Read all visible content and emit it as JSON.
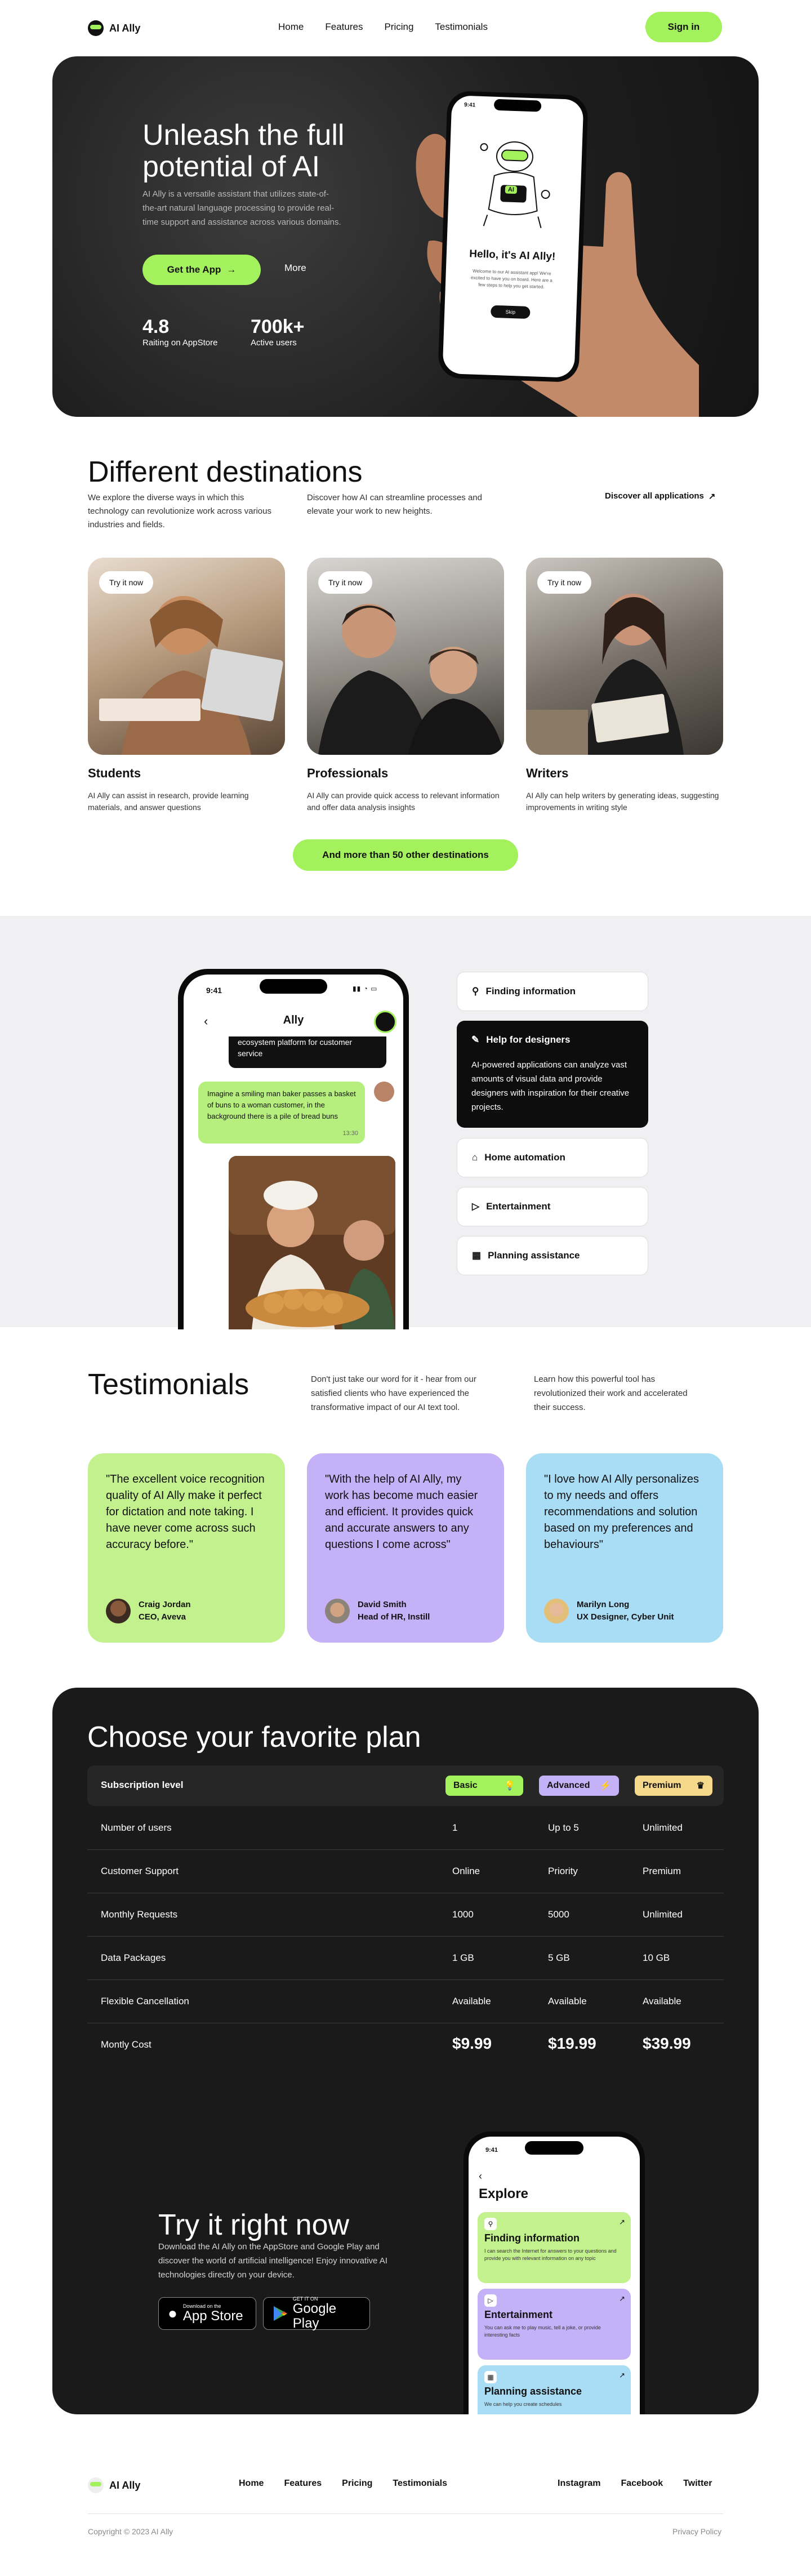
{
  "brand": {
    "name": "AI Ally"
  },
  "nav": {
    "items": [
      "Home",
      "Features",
      "Pricing",
      "Testimonials"
    ],
    "signin": "Sign in"
  },
  "hero": {
    "title": "Unleash the full potential of AI",
    "description": "AI Ally is a versatile assistant that utilizes state-of-the-art natural language processing to provide real-time support and assistance across various domains.",
    "cta": "Get the App",
    "more": "More",
    "stats": [
      {
        "value": "4.8",
        "label": "Raiting on AppStore"
      },
      {
        "value": "700k+",
        "label": "Active users"
      }
    ],
    "phone": {
      "time": "9:41",
      "badge": "AI",
      "title": "Hello, it's AI Ally!",
      "text": "Welcome to our AI assistant app! We're excited to have you on board. Here are a few steps to help you get started.",
      "button": "Skip"
    }
  },
  "destinations": {
    "title": "Different destinations",
    "intro1": "We explore the diverse ways in which this technology can revolutionize work across various industries and fields.",
    "intro2": "Discover how AI can streamline processes and elevate your work to new heights.",
    "link": "Discover all applications",
    "cards": [
      {
        "pill": "Try it now",
        "title": "Students",
        "text": "AI Ally can assist in research, provide learning materials, and answer questions"
      },
      {
        "pill": "Try it now",
        "title": "Professionals",
        "text": "AI Ally can provide quick access to relevant information and offer data analysis insights"
      },
      {
        "pill": "Try it now",
        "title": "Writers",
        "text": "AI Ally can help writers by generating ideas, suggesting improvements in writing style"
      }
    ],
    "more_button": "And more than 50 other destinations"
  },
  "chat": {
    "time": "9:41",
    "title": "Ally",
    "prev_message": "ecosystem platform for customer service",
    "message": "Imagine a smiling man baker passes a basket of buns to a woman customer, in the background there is a pile of bread buns",
    "message_time": "13:30"
  },
  "features": {
    "items": [
      "Finding information",
      "Help for designers",
      "Home automation",
      "Entertainment",
      "Planning assistance"
    ],
    "active_text": "AI-powered applications can analyze vast amounts of visual data and provide designers with inspiration for their creative projects."
  },
  "testimonials": {
    "title": "Testimonials",
    "intro1": "Don't just take our word for it - hear from our satisfied clients who have experienced the transformative impact of our AI text tool.",
    "intro2": "Learn how this powerful tool has revolutionized their work and accelerated their success.",
    "cards": [
      {
        "quote": "\"The excellent voice recognition quality of AI Ally make it perfect for dictation and note taking. I have never come across such accuracy before.\"",
        "name": "Craig Jordan",
        "role": "CEO, Aveva",
        "color": "#c3f18e"
      },
      {
        "quote": "\"With the help of AI Ally, my work has become much easier and efficient. It provides quick and accurate answers to any questions I come across\"",
        "name": "David Smith",
        "role": "Head of HR, Instill",
        "color": "#c4b1f7"
      },
      {
        "quote": "\"I love how AI Ally personalizes to my needs and offers recommendations and solution based on my preferences and behaviours\"",
        "name": "Marilyn Long",
        "role": "UX Designer, Cyber Unit",
        "color": "#a9dcf5"
      }
    ]
  },
  "pricing": {
    "title": "Choose your favorite plan",
    "header_label": "Subscription level",
    "tiers": [
      {
        "name": "Basic",
        "color": "#a3f15c"
      },
      {
        "name": "Advanced",
        "color": "#c4b1f7"
      },
      {
        "name": "Premium",
        "color": "#f5d88a"
      }
    ],
    "rows": [
      {
        "label": "Number of users",
        "values": [
          "1",
          "Up to 5",
          "Unlimited"
        ]
      },
      {
        "label": "Customer Support",
        "values": [
          "Online",
          "Priority",
          "Premium"
        ]
      },
      {
        "label": "Monthly Requests",
        "values": [
          "1000",
          "5000",
          "Unlimited"
        ]
      },
      {
        "label": "Data Packages",
        "values": [
          "1 GB",
          "5 GB",
          "10 GB"
        ]
      },
      {
        "label": "Flexible Cancellation",
        "values": [
          "Available",
          "Available",
          "Available"
        ]
      },
      {
        "label": "Montly Cost",
        "values": [
          "$9.99",
          "$19.99",
          "$39.99"
        ]
      }
    ]
  },
  "try": {
    "title": "Try it right now",
    "description": "Download the AI Ally on the AppStore and Google Play and discover the world of artificial intelligence! Enjoy innovative AI technologies directly on your device.",
    "appstore_small": "Download on the",
    "appstore_big": "App Store",
    "gplay_small": "GET IT ON",
    "gplay_big": "Google Play",
    "phone": {
      "time": "9:41",
      "title": "Explore",
      "cards": [
        {
          "title": "Finding information",
          "text": "I can search the Internet for answers to your questions and provide you with relevant information on any topic",
          "color": "#c3f18e"
        },
        {
          "title": "Entertainment",
          "text": "You can ask me to play music, tell a joke, or provide interesting facts",
          "color": "#c4b1f7"
        },
        {
          "title": "Planning assistance",
          "text": "We can help you create schedules",
          "color": "#a9dcf5"
        }
      ]
    }
  },
  "footer": {
    "nav": [
      "Home",
      "Features",
      "Pricing",
      "Testimonials"
    ],
    "social": [
      "Instagram",
      "Facebook",
      "Twitter"
    ],
    "copyright": "Copyright © 2023 AI Ally",
    "privacy": "Privacy Policy"
  }
}
